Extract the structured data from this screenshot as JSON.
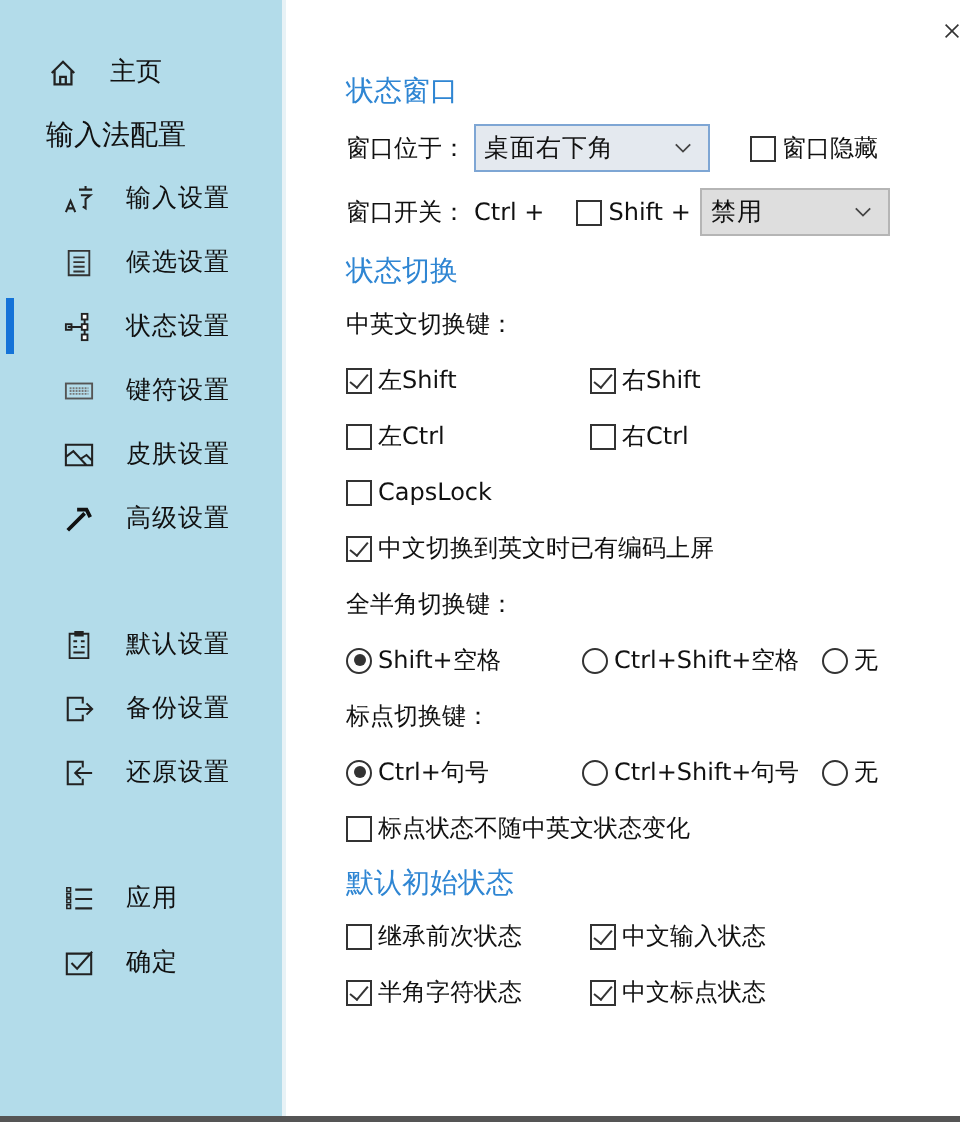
{
  "sidebar": {
    "home": "主页",
    "title": "输入法配置",
    "groups": [
      [
        {
          "label": "输入设置",
          "kind": "font",
          "selected": false
        },
        {
          "label": "候选设置",
          "kind": "list",
          "selected": false
        },
        {
          "label": "状态设置",
          "kind": "tree",
          "selected": true
        },
        {
          "label": "键符设置",
          "kind": "keyboard",
          "selected": false
        },
        {
          "label": "皮肤设置",
          "kind": "image",
          "selected": false
        },
        {
          "label": "高级设置",
          "kind": "hammer",
          "selected": false
        }
      ],
      [
        {
          "label": "默认设置",
          "kind": "doc",
          "selected": false
        },
        {
          "label": "备份设置",
          "kind": "export",
          "selected": false
        },
        {
          "label": "还原设置",
          "kind": "import",
          "selected": false
        }
      ],
      [
        {
          "label": "应用",
          "kind": "bullets",
          "selected": false
        },
        {
          "label": "确定",
          "kind": "check",
          "selected": false
        }
      ]
    ]
  },
  "status_window": {
    "title": "状态窗口",
    "position_label": "窗口位于：",
    "position_value": "桌面右下角",
    "hide": {
      "label": "窗口隐藏",
      "checked": false
    },
    "toggle_label": "窗口开关：",
    "ctrl": "Ctrl +",
    "shift": {
      "label": "Shift +",
      "checked": false
    },
    "toggle_value": "禁用"
  },
  "status_switch": {
    "title": "状态切换",
    "cn_en_label": "中英文切换键：",
    "cn_en_keys": [
      {
        "label": "左Shift",
        "checked": true
      },
      {
        "label": "右Shift",
        "checked": true
      },
      {
        "label": "左Ctrl",
        "checked": false
      },
      {
        "label": "右Ctrl",
        "checked": false
      }
    ],
    "capslock": {
      "label": "CapsLock",
      "checked": false
    },
    "commit": {
      "label": "中文切换到英文时已有编码上屏",
      "checked": true
    },
    "width_label": "全半角切换键：",
    "width_options": [
      {
        "label": "Shift+空格",
        "selected": true
      },
      {
        "label": "Ctrl+Shift+空格",
        "selected": false
      },
      {
        "label": "无",
        "selected": false
      }
    ],
    "punct_label": "标点切换键：",
    "punct_options": [
      {
        "label": "Ctrl+句号",
        "selected": true
      },
      {
        "label": "Ctrl+Shift+句号",
        "selected": false
      },
      {
        "label": "无",
        "selected": false
      }
    ],
    "punct_independent": {
      "label": "标点状态不随中英文状态变化",
      "checked": false
    }
  },
  "default_state": {
    "title": "默认初始状态",
    "options": [
      {
        "label": "继承前次状态",
        "checked": false
      },
      {
        "label": "中文输入状态",
        "checked": true
      },
      {
        "label": "半角字符状态",
        "checked": true
      },
      {
        "label": "中文标点状态",
        "checked": true
      }
    ]
  }
}
